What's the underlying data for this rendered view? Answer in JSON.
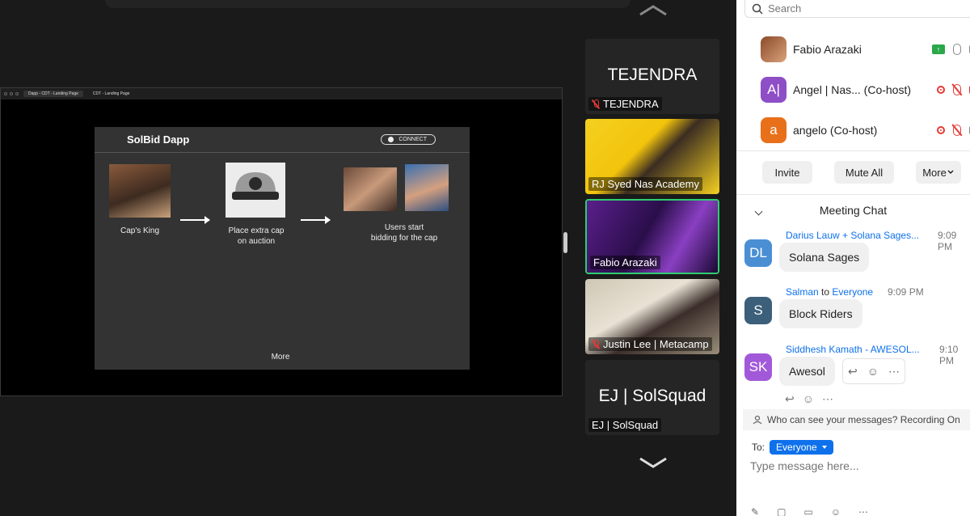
{
  "share": {
    "browser_tabs": [
      "Dapp - CDT - Landing Page",
      "CDT - Landing Page"
    ],
    "app_title": "SolBid Dapp",
    "connect_label": "CONNECT",
    "step1": "Cap's King",
    "step2_line1": "Place extra cap",
    "step2_line2": "on auction",
    "step3_line1": "Users start",
    "step3_line2": "bidding for the cap",
    "more_label": "More"
  },
  "videos": [
    {
      "big": "TEJENDRA",
      "name": "TEJENDRA",
      "muted": true
    },
    {
      "name": "RJ Syed Nas Academy",
      "muted": false
    },
    {
      "name": "Fabio Arazaki",
      "muted": false,
      "active": true
    },
    {
      "name": "Justin Lee | Metacamp",
      "muted": true
    },
    {
      "big": "EJ | SolSquad",
      "name": "EJ | SolSquad",
      "muted": false
    }
  ],
  "panel": {
    "search_placeholder": "Search",
    "participants": [
      {
        "initials": "",
        "name": "Fabio Arazaki",
        "color": "#c0703a"
      },
      {
        "initials": "A|",
        "name": "Angel | Nas... (Co-host)",
        "color": "#8e4ec6"
      },
      {
        "initials": "a",
        "name": "angelo (Co-host)",
        "color": "#e8701a"
      }
    ],
    "invite_label": "Invite",
    "mute_all_label": "Mute All",
    "more_label": "More",
    "chat_title": "Meeting Chat",
    "messages": [
      {
        "initials": "DL",
        "color": "#4a8fd4",
        "sender": "Darius Lauw + Solana Sages...",
        "to": "",
        "recipient": "",
        "time": "9:09 PM",
        "text": "Solana Sages"
      },
      {
        "initials": "S",
        "color": "#3c5f7a",
        "sender": "Salman",
        "to": "to",
        "recipient": "Everyone",
        "time": "9:09 PM",
        "text": "Block Riders"
      },
      {
        "initials": "SK",
        "color": "#a259d9",
        "sender": "Siddhesh Kamath - AWESOL...",
        "to": "",
        "recipient": "",
        "time": "9:10 PM",
        "text": "Awesol"
      }
    ],
    "notice": "Who can see your messages? Recording On",
    "to_label": "To:",
    "to_value": "Everyone",
    "input_placeholder": "Type message here..."
  }
}
